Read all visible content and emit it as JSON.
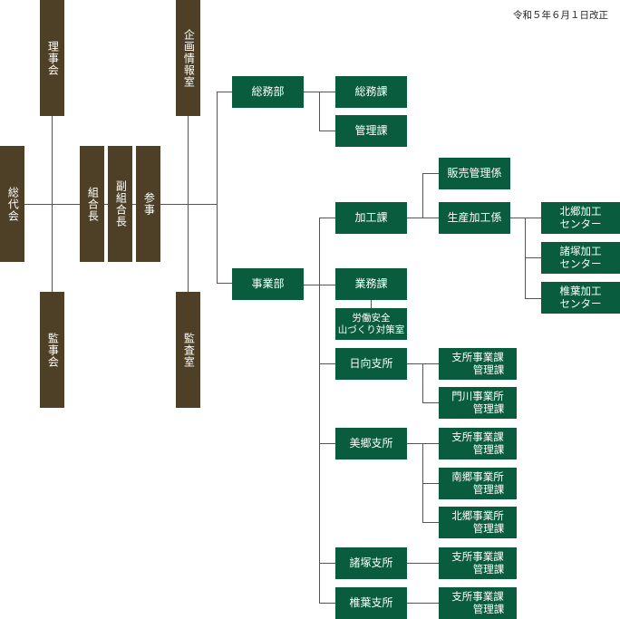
{
  "revision_note": "令和５年６月１日改正",
  "governance": {
    "sodaikai": "総代会",
    "rijikai": "理事会",
    "kanjikai": "監事会",
    "kumiaicho": "組合長",
    "fukukumiaicho": "副組合長",
    "sanji": "参事",
    "kikaku": "企画情報室",
    "kansa": "監査室"
  },
  "somubu": {
    "label": "総務部",
    "somuka": "総務課",
    "kanrika": "管理課"
  },
  "jigyobu": {
    "label": "事業部",
    "kakoka": "加工課",
    "hanbai": "販売管理係",
    "seisan": "生産加工係",
    "centers": [
      {
        "line1": "北郷加工",
        "line2": "センター"
      },
      {
        "line1": "諸塚加工",
        "line2": "センター"
      },
      {
        "line1": "椎葉加工",
        "line2": "センター"
      }
    ],
    "gyomuka": "業務課",
    "rodo": {
      "line1": "労働安全",
      "line2": "山づくり対策室"
    },
    "hyuga": {
      "label": "日向支所",
      "sub1": {
        "line1": "支所事業課",
        "line2": "管理課"
      },
      "sub2": {
        "line1": "門川事業所",
        "line2": "管理課"
      }
    },
    "misato": {
      "label": "美郷支所",
      "sub1": {
        "line1": "支所事業課",
        "line2": "管理課"
      },
      "sub2": {
        "line1": "南郷事業所",
        "line2": "管理課"
      },
      "sub3": {
        "line1": "北郷事業所",
        "line2": "管理課"
      }
    },
    "morotsuka": {
      "label": "諸塚支所",
      "sub1": {
        "line1": "支所事業課",
        "line2": "管理課"
      }
    },
    "shiiba": {
      "label": "椎葉支所",
      "sub1": {
        "line1": "支所事業課",
        "line2": "管理課"
      }
    }
  }
}
